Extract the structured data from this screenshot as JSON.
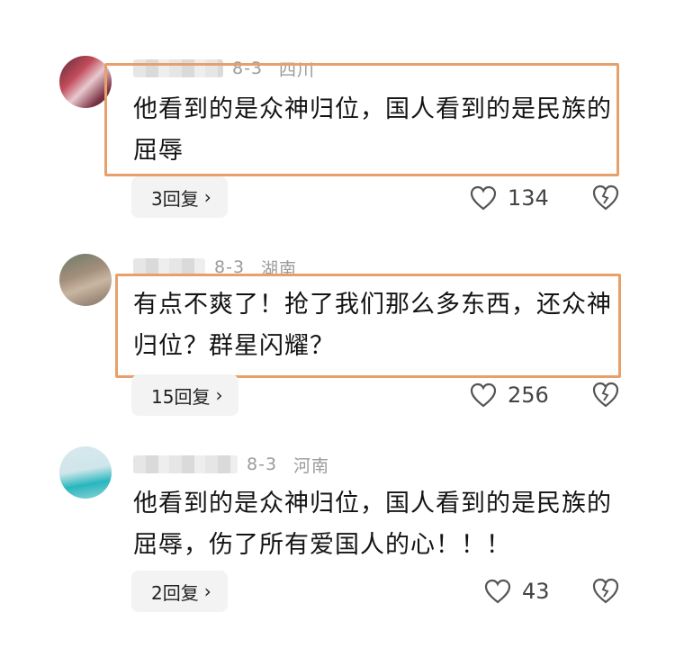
{
  "comments": [
    {
      "user": "",
      "date": "8-3",
      "location": "四川",
      "text": "他看到的是众神归位，国人看到的是民族的屈辱",
      "replies_label": "3回复",
      "likes": "134"
    },
    {
      "user": "",
      "date": "8-3",
      "location": "湖南",
      "text": "有点不爽了！抢了我们那么多东西，还众神归位？群星闪耀？",
      "replies_label": "15回复",
      "likes": "256"
    },
    {
      "user": "",
      "date": "8-3",
      "location": "河南",
      "text": "他看到的是众神归位，国人看到的是民族的屈辱，伤了所有爱国人的心！！！",
      "replies_label": "2回复",
      "likes": "43"
    }
  ],
  "icons": {
    "like": "heart-outline-icon",
    "dislike": "broken-heart-icon",
    "chevron": "chevron-right-icon"
  },
  "colors": {
    "highlight_border": "#e8a06a",
    "reply_bg": "#f3f3f3",
    "meta_text": "#9b9b9b"
  }
}
